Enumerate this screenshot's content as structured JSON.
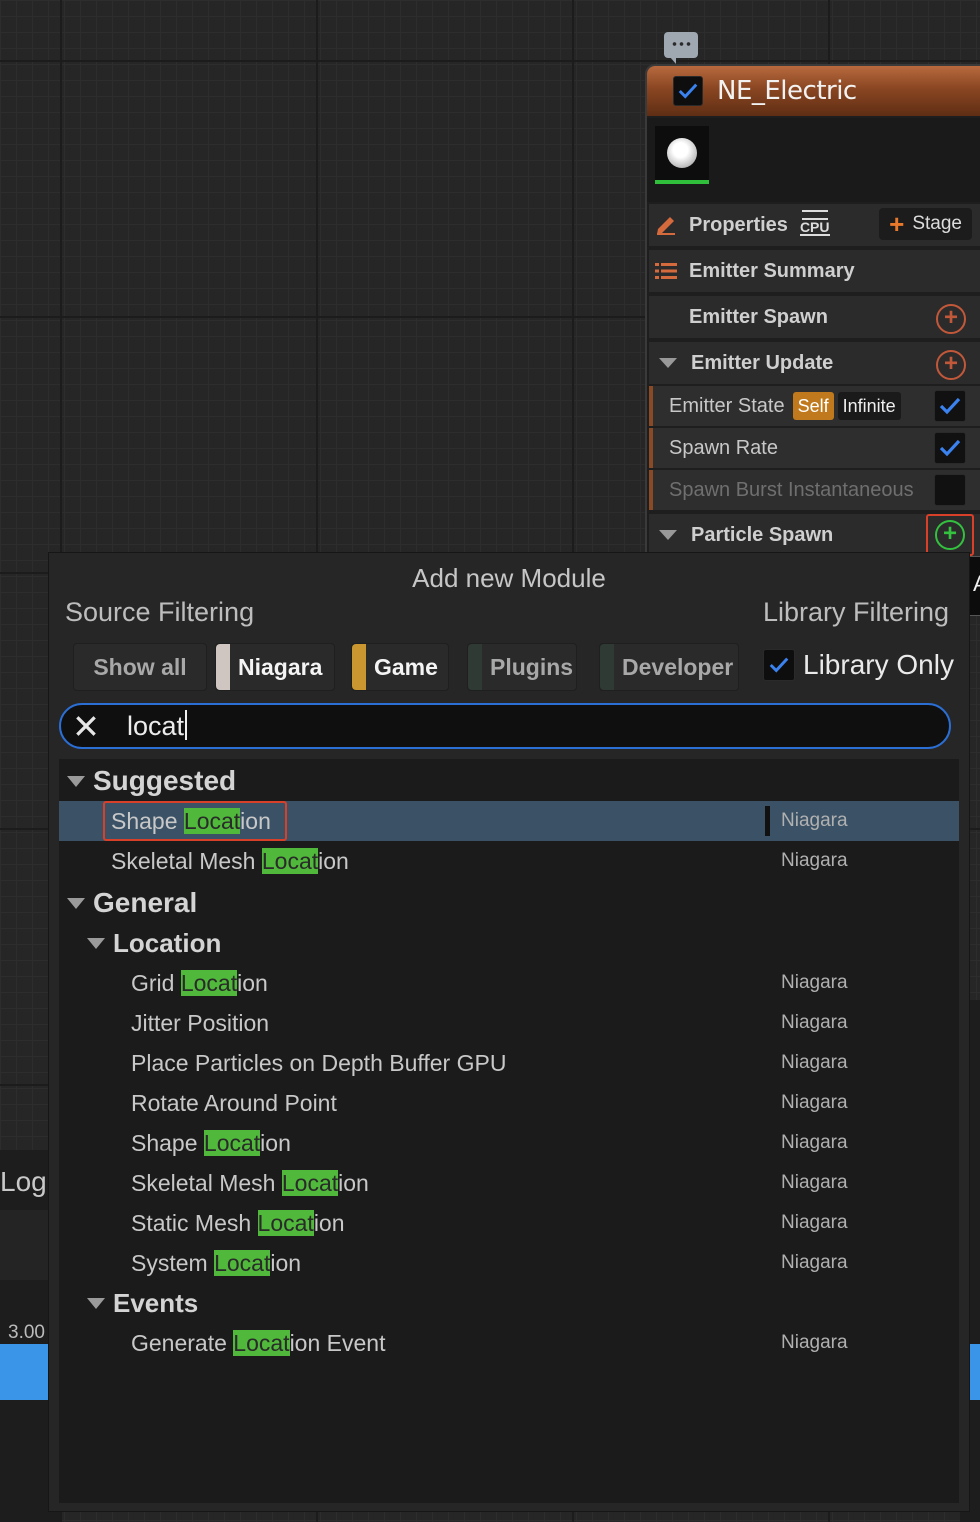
{
  "node": {
    "title": "NE_Electric",
    "properties_label": "Properties",
    "cpu_label": "CPU",
    "stage_label": "Stage",
    "emitter_summary_label": "Emitter Summary",
    "emitter_spawn_label": "Emitter Spawn",
    "emitter_update_label": "Emitter Update",
    "modules": [
      {
        "label": "Emitter State",
        "tags": [
          "Self",
          "Infinite"
        ],
        "enabled": true
      },
      {
        "label": "Spawn Rate",
        "enabled": true
      },
      {
        "label": "Spawn Burst Instantaneous",
        "enabled": false
      }
    ],
    "particle_spawn_label": "Particle Spawn"
  },
  "tooltip_stub": "A",
  "popup": {
    "title": "Add new Module",
    "source_filtering_label": "Source Filtering",
    "library_filtering_label": "Library Filtering",
    "chips": [
      {
        "label": "Show all",
        "color": "",
        "active": false
      },
      {
        "label": "Niagara",
        "color": "#cfc6c2",
        "active": true
      },
      {
        "label": "Game",
        "color": "#c9962f",
        "active": true
      },
      {
        "label": "Plugins",
        "color": "#2e3a33",
        "active": false
      },
      {
        "label": "Developer",
        "color": "#2e3a33",
        "active": false
      }
    ],
    "library_only_label": "Library Only",
    "search_value": "locat",
    "results": {
      "suggested_label": "Suggested",
      "suggested": [
        {
          "pre": "Shape ",
          "match": "Locat",
          "post": "ion",
          "library": "Niagara"
        },
        {
          "pre": "Skeletal Mesh ",
          "match": "Locat",
          "post": "ion",
          "library": "Niagara"
        }
      ],
      "general_label": "General",
      "location_label": "Location",
      "location": [
        {
          "pre": "Grid ",
          "match": "Locat",
          "post": "ion",
          "library": "Niagara"
        },
        {
          "pre": "Jitter Position",
          "match": "",
          "post": "",
          "library": "Niagara"
        },
        {
          "pre": "Place Particles on Depth Buffer GPU",
          "match": "",
          "post": "",
          "library": "Niagara"
        },
        {
          "pre": "Rotate Around Point",
          "match": "",
          "post": "",
          "library": "Niagara"
        },
        {
          "pre": "Shape ",
          "match": "Locat",
          "post": "ion",
          "library": "Niagara"
        },
        {
          "pre": "Skeletal Mesh ",
          "match": "Locat",
          "post": "ion",
          "library": "Niagara"
        },
        {
          "pre": "Static Mesh ",
          "match": "Locat",
          "post": "ion",
          "library": "Niagara"
        },
        {
          "pre": "System ",
          "match": "Locat",
          "post": "ion",
          "library": "Niagara"
        }
      ],
      "events_label": "Events",
      "events": [
        {
          "pre": "Generate ",
          "match": "Locat",
          "post": "ion Event",
          "library": "Niagara"
        }
      ]
    }
  },
  "background": {
    "log_text": "Log",
    "number": "3.00"
  }
}
